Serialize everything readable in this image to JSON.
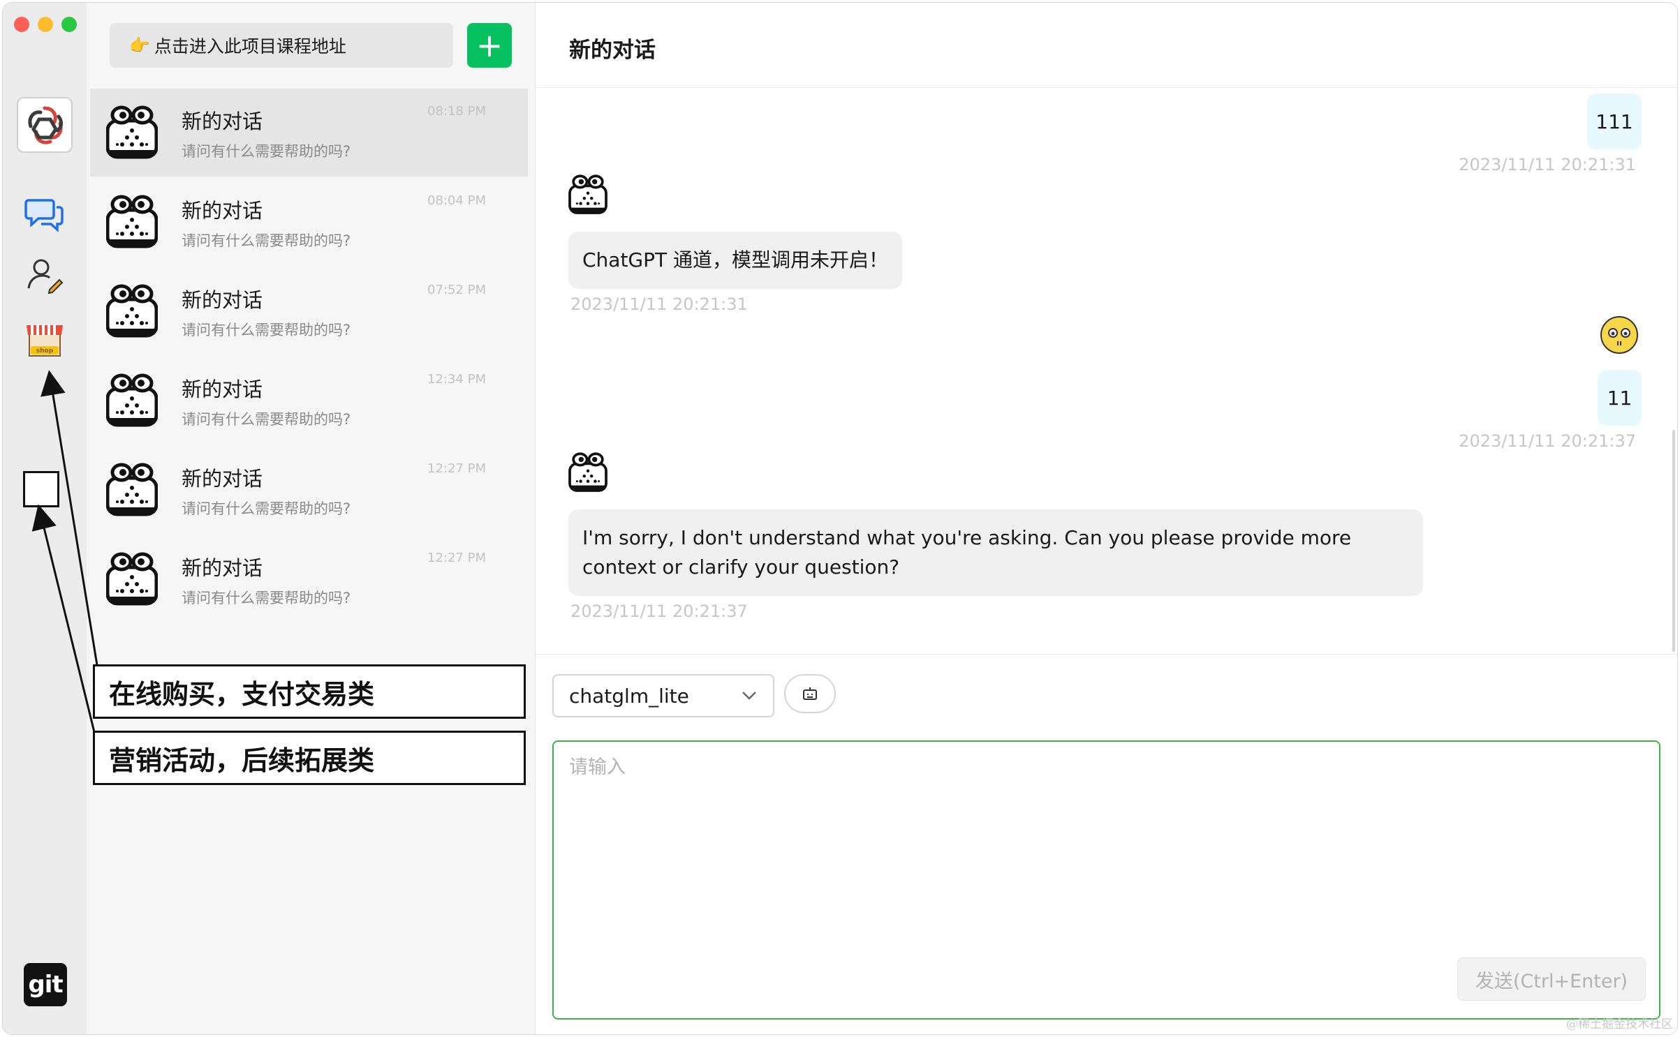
{
  "window": {
    "traffic_lights": {
      "close": "#fe5f57",
      "minimize": "#febc2e",
      "zoom": "#28c840"
    }
  },
  "rail": {
    "icons": [
      "chatgpt-logo-icon",
      "chat-bubbles-icon",
      "user-edit-icon",
      "shop-icon",
      "empty-square-icon",
      "git-logo-icon"
    ],
    "shop_label": "shop",
    "git_label": "git"
  },
  "sessions": {
    "course_button_emoji": "👉",
    "course_button_label": "点击进入此项目课程地址",
    "add_button_label": "+",
    "items": [
      {
        "title": "新的对话",
        "subtitle": "请问有什么需要帮助的吗?",
        "time": "08:18 PM"
      },
      {
        "title": "新的对话",
        "subtitle": "请问有什么需要帮助的吗?",
        "time": "08:04 PM"
      },
      {
        "title": "新的对话",
        "subtitle": "请问有什么需要帮助的吗?",
        "time": "07:52 PM"
      },
      {
        "title": "新的对话",
        "subtitle": "请问有什么需要帮助的吗?",
        "time": "12:34 PM"
      },
      {
        "title": "新的对话",
        "subtitle": "请问有什么需要帮助的吗?",
        "time": "12:27 PM"
      },
      {
        "title": "新的对话",
        "subtitle": "请问有什么需要帮助的吗?",
        "time": "12:27 PM"
      }
    ]
  },
  "annotations": {
    "shop": "在线购买，支付交易类",
    "marketing": "营销活动，后续拓展类"
  },
  "chat": {
    "title": "新的对话",
    "messages": [
      {
        "role": "user",
        "text": "111",
        "time": "2023/11/11 20:21:31"
      },
      {
        "role": "bot",
        "text": "ChatGPT 通道，模型调用未开启！",
        "time": "2023/11/11 20:21:31"
      },
      {
        "role": "user",
        "text": "11",
        "time": "2023/11/11 20:21:37"
      },
      {
        "role": "bot",
        "text": "I'm sorry, I don't understand what you're asking. Can you please provide more context or clarify your question?",
        "time": "2023/11/11 20:21:37"
      }
    ],
    "model_select": "chatglm_lite",
    "input_placeholder": "请输入",
    "send_label": "发送(Ctrl+Enter)"
  },
  "colors": {
    "accent_green": "#07c160",
    "input_border": "#3bb54a",
    "user_bubble": "#e7f8ff",
    "bot_bubble": "#f0f0f0"
  },
  "watermark": "@稀土掘金技术社区"
}
